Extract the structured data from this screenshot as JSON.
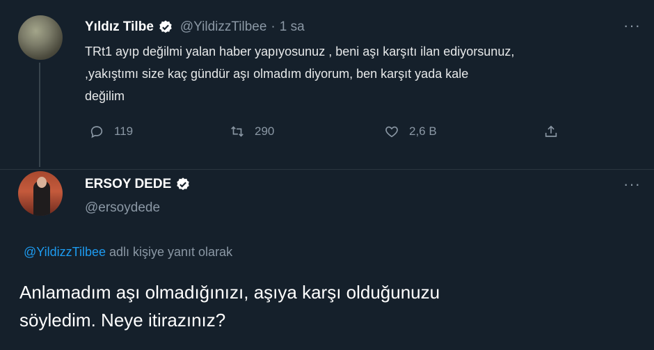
{
  "tweet1": {
    "name": "Yıldız Tilbe",
    "handle": "@YildizzTilbee",
    "dot": "·",
    "time": "1 sa",
    "text_line1": "TRt1 ayıp değilmi yalan haber yapıyosunuz , beni aşı karşıtı ilan ediyorsunuz,",
    "text_line2": ",yakıştımı size kaç gündür aşı olmadım diyorum, ben  karşıt yada kale",
    "text_line3": "değilim",
    "more": "···",
    "replies": "119",
    "retweets": "290",
    "likes": "2,6 B",
    "icons": [
      "reply-icon",
      "retweet-icon",
      "like-icon",
      "share-icon"
    ]
  },
  "tweet2": {
    "name": "ERSOY DEDE",
    "handle": "@ersoydede",
    "more": "···",
    "reply_to_handle": "@YildizzTilbee",
    "reply_to_suffix": " adlı kişiye yanıt olarak",
    "text_line1": "Anlamadım aşı olmadığınızı, aşıya karşı olduğunuzu",
    "text_line2": "söyledim. Neye itirazınız?"
  },
  "colors": {
    "background": "#15202b",
    "secondary_text": "#8b98a5",
    "link": "#1d9bf0",
    "verified_badge": "#ffffff"
  }
}
